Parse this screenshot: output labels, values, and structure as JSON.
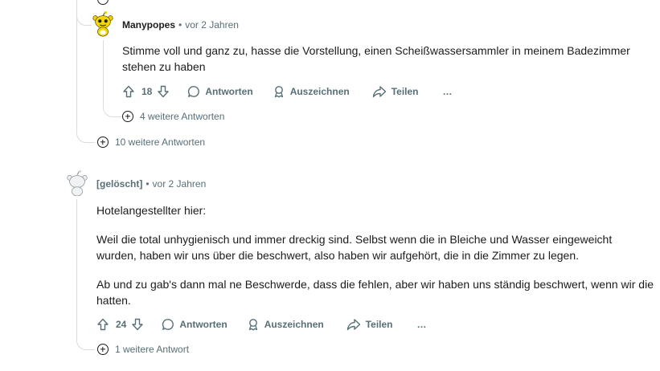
{
  "comment_reply": {
    "author": "Manypopes",
    "time": "vor 2 Jahren",
    "body": "Stimme voll und ganz zu, hasse die Vorstellung, einen Scheißwassersammler in meinem Badezimmer stehen zu haben",
    "score": "18",
    "reply_label": "Antworten",
    "award_label": "Auszeichnen",
    "share_label": "Teilen",
    "more_label": "…",
    "more_replies": "4 weitere Antworten"
  },
  "parent_more_replies": "10 weitere Antworten",
  "comment_deleted": {
    "author": "[gelöscht]",
    "time": "vor 2 Jahren",
    "paragraphs": [
      "Hotelangestellter hier:",
      "Weil die total unhygienisch und immer dreckig sind. Selbst wenn die in Bleiche und Wasser eingeweicht wurden, haben wir uns über die beschwert, also haben wir aufgehört, die in die Zimmer zu legen.",
      "Ab und zu gab's dann mal ne Beschwerde, dass die fehlen, aber wir haben uns ständig beschwert, wenn wir die hatten."
    ],
    "score": "24",
    "reply_label": "Antworten",
    "award_label": "Auszeichnen",
    "share_label": "Teilen",
    "more_label": "…",
    "more_replies": "1 weitere Antwort"
  },
  "meta_separator": "•"
}
